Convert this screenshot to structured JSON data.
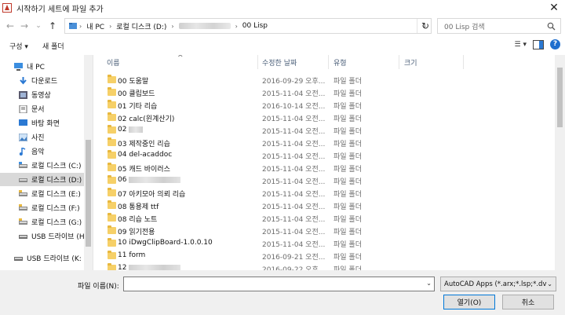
{
  "window": {
    "title": "시작하기 세트에 파일 추가",
    "close_glyph": "✕"
  },
  "nav": {
    "back": "←",
    "forward": "→",
    "recent": "⌄",
    "up": "↑"
  },
  "address": {
    "crumbs": [
      "내 PC",
      "로컬 디스크 (D:)",
      "00 Lisp"
    ],
    "separator": "›",
    "dropdown_glyph": "⌄",
    "refresh_glyph": "↻"
  },
  "search": {
    "placeholder": "00 Lisp 검색",
    "icon": "search-icon"
  },
  "toolbar": {
    "organize": "구성 ▾",
    "new_folder": "새 폴더",
    "view_glyph": "☰ ▾",
    "help_glyph": "?"
  },
  "sidebar": {
    "items": [
      {
        "label": "내 PC",
        "icon": "pc-icon"
      },
      {
        "label": "다운로드",
        "icon": "download-icon"
      },
      {
        "label": "동영상",
        "icon": "video-icon"
      },
      {
        "label": "문서",
        "icon": "document-icon"
      },
      {
        "label": "바탕 화면",
        "icon": "desktop-icon"
      },
      {
        "label": "사진",
        "icon": "picture-icon"
      },
      {
        "label": "음악",
        "icon": "music-icon"
      },
      {
        "label": "로컬 디스크 (C:)",
        "icon": "drive-icon"
      },
      {
        "label": "로컬 디스크 (D:)",
        "icon": "drive-icon",
        "selected": true
      },
      {
        "label": "로컬 디스크 (E:)",
        "icon": "drive-icon"
      },
      {
        "label": "로컬 디스크 (F:)",
        "icon": "drive-icon"
      },
      {
        "label": "로컬 디스크 (G:)",
        "icon": "drive-icon"
      },
      {
        "label": "USB 드라이브 (H:",
        "icon": "usb-icon"
      },
      {
        "label": "USB 드라이브 (K:",
        "icon": "usb-icon"
      }
    ]
  },
  "columns": {
    "name": "이름",
    "date": "수정한 날짜",
    "type": "유형",
    "size": "크기",
    "sort_glyph": "^"
  },
  "files": [
    {
      "name": "00 도움말",
      "date": "2016-09-29 오후...",
      "type": "파일 폴더"
    },
    {
      "name": "00 클립보드",
      "date": "2015-11-04 오전...",
      "type": "파일 폴더"
    },
    {
      "name": "01 기타 리습",
      "date": "2016-10-14 오전...",
      "type": "파일 폴더"
    },
    {
      "name": "02 calc(윈계산기)",
      "date": "2015-11-04 오전...",
      "type": "파일 폴더"
    },
    {
      "name": "02",
      "date": "2015-11-04 오전...",
      "type": "파일 폴더",
      "blur": "small"
    },
    {
      "name": "03 제작중인 리습",
      "date": "2015-11-04 오전...",
      "type": "파일 폴더"
    },
    {
      "name": "04 del-acaddoc",
      "date": "2015-11-04 오전...",
      "type": "파일 폴더"
    },
    {
      "name": "05 캐드 바이러스",
      "date": "2015-11-04 오전...",
      "type": "파일 폴더"
    },
    {
      "name": "06",
      "date": "2015-11-04 오전...",
      "type": "파일 폴더",
      "blur": "big"
    },
    {
      "name": "07 아키모아 의뢰 리습",
      "date": "2015-11-04 오전...",
      "type": "파일 폴더"
    },
    {
      "name": "08 통용제 ttf",
      "date": "2015-11-04 오전...",
      "type": "파일 폴더"
    },
    {
      "name": "08 리습 노트",
      "date": "2015-11-04 오전...",
      "type": "파일 폴더"
    },
    {
      "name": "09 읽기전용",
      "date": "2015-11-04 오전...",
      "type": "파일 폴더"
    },
    {
      "name": "10 iDwgClipBoard-1.0.0.10",
      "date": "2015-11-04 오전...",
      "type": "파일 폴더"
    },
    {
      "name": "11 form",
      "date": "2016-09-21 오전...",
      "type": "파일 폴더"
    },
    {
      "name": "12",
      "date": "2016-09-22 오후...",
      "type": "파일 폴더",
      "blur": "big"
    }
  ],
  "footer": {
    "filename_label": "파일 이름(N):",
    "filename_value": "",
    "filetype_value": "AutoCAD Apps (*.arx;*.lsp;*.dv",
    "dropdown_glyph": "⌄",
    "open": "열기(O)",
    "cancel": "취소"
  }
}
